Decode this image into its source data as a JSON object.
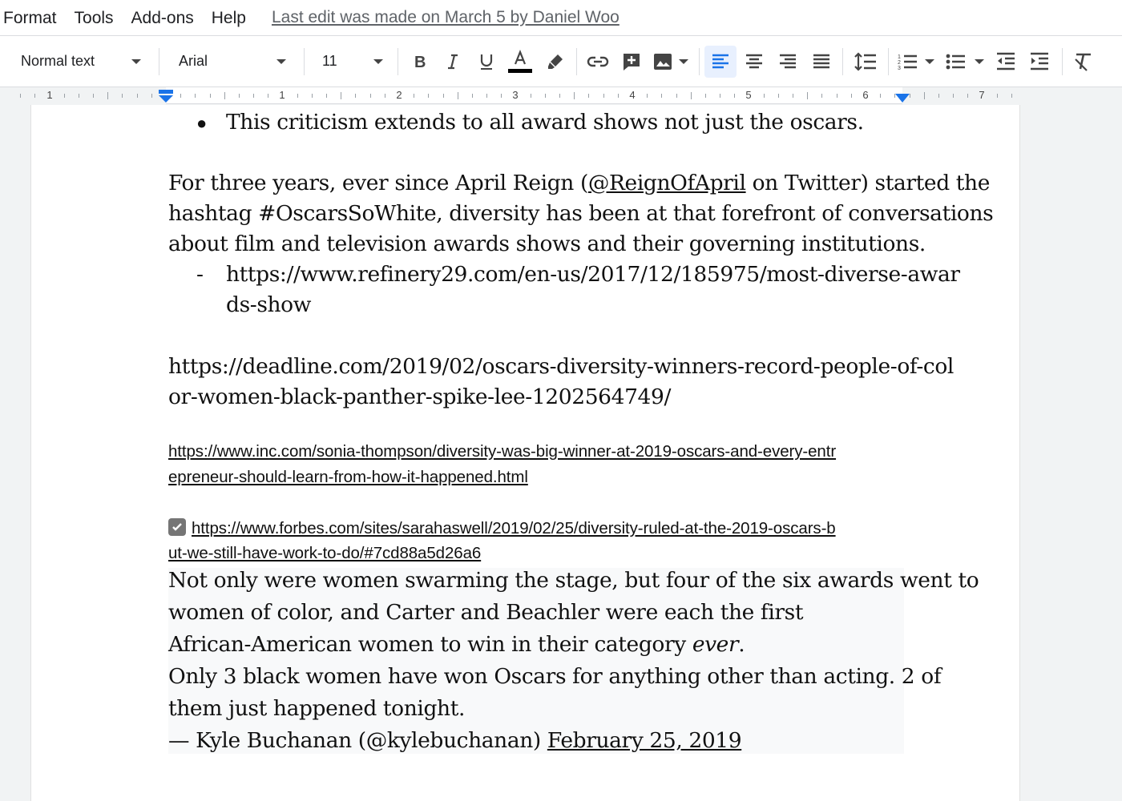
{
  "menu": {
    "items": [
      "Format",
      "Tools",
      "Add-ons",
      "Help"
    ],
    "last_edit": "Last edit was made on March 5 by Daniel Woo"
  },
  "toolbar": {
    "style": "Normal text",
    "font": "Arial",
    "size": "11"
  },
  "ruler": {
    "numbers": [
      "1",
      "1",
      "2",
      "3",
      "4",
      "5",
      "6",
      "7"
    ]
  },
  "doc": {
    "bullet_line": "This criticism extends to all award shows not just the oscars.",
    "para1_pre": "For three years, ever since April Reign (",
    "para1_handle": "@ReignOfApril",
    "para1_post": " on Twitter) started the",
    "para1_line2": "hashtag #OscarsSoWhite, diversity has been at that forefront of conversations",
    "para1_line3": "about film and television awards shows and their governing institutions.",
    "dash_marker": "-",
    "refinery_line1": "https://www.refinery29.com/en-us/2017/12/185975/most-diverse-awar",
    "refinery_line2": "ds-show",
    "deadline_line1": "https://deadline.com/2019/02/oscars-diversity-winners-record-people-of-col",
    "deadline_line2": "or-women-black-panther-spike-lee-1202564749/",
    "inc_line1": "https://www.inc.com/sonia-thompson/diversity-was-big-winner-at-2019-oscars-and-every-entr",
    "inc_line2": "epreneur-should-learn-from-how-it-happened.html",
    "forbes_line1": "https://www.forbes.com/sites/sarahaswell/2019/02/25/diversity-ruled-at-the-2019-oscars-b",
    "forbes_line2": "ut-we-still-have-work-to-do/#7cd88a5d26a6",
    "quote1_line1": "Not only were women swarming the stage, but four of the six awards went to",
    "quote1_line2": "women of color, and Carter and Beachler were each the first",
    "quote1_line3_pre": "African-American women to win in their category ",
    "quote1_line3_em": "ever",
    "quote1_line3_post": ".",
    "quote2_line1": "Only 3 black women have won Oscars for anything other than acting. 2 of",
    "quote2_line2": "them just happened tonight.",
    "quote2_attrib": "— Kyle Buchanan (@kylebuchanan) ",
    "quote2_date": "February 25, 2019"
  },
  "colors": {
    "accent": "#1a73e8",
    "active_bg": "#e8f0fe",
    "text_color_bar": "#000000"
  },
  "icons": [
    "bold-icon",
    "italic-icon",
    "underline-icon",
    "text-color-icon",
    "highlight-icon",
    "link-icon",
    "insert-comment-icon",
    "insert-image-icon",
    "align-left-icon",
    "align-center-icon",
    "align-right-icon",
    "justify-icon",
    "line-spacing-icon",
    "numbered-list-icon",
    "bulleted-list-icon",
    "decrease-indent-icon",
    "increase-indent-icon",
    "clear-formatting-icon",
    "checkbox-icon"
  ]
}
